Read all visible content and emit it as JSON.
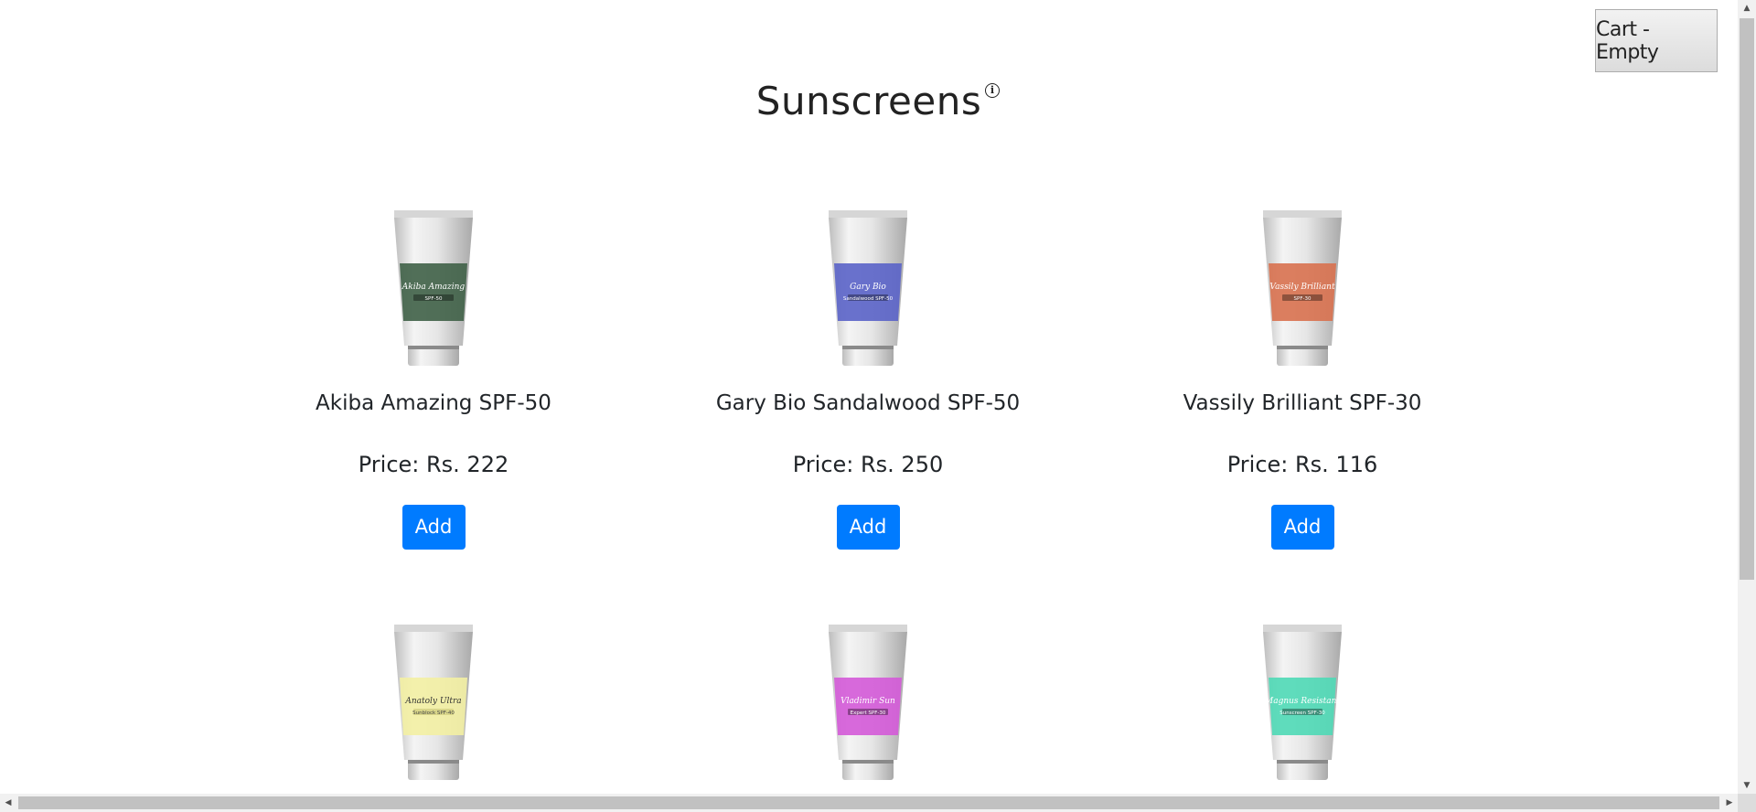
{
  "cart": {
    "label": "Cart - Empty"
  },
  "page": {
    "title": "Sunscreens",
    "info_icon": "info-icon"
  },
  "products": [
    {
      "name": "Akiba Amazing SPF-50",
      "price": "Price: Rs. 222",
      "button": "Add",
      "label_text": "Akiba Amazing",
      "label_sub": "SPF-50",
      "color": "#3f6147"
    },
    {
      "name": "Gary Bio Sandalwood SPF-50",
      "price": "Price: Rs. 250",
      "button": "Add",
      "label_text": "Gary Bio",
      "label_sub": "Sandalwood SPF-50",
      "color": "#5a63c8"
    },
    {
      "name": "Vassily Brilliant SPF-30",
      "price": "Price: Rs. 116",
      "button": "Add",
      "label_text": "Vassily Brilliant",
      "label_sub": "SPF-30",
      "color": "#d8714f"
    },
    {
      "label_text": "Anatoly Ultra",
      "label_sub": "Sunblock SPF-40",
      "color": "#f3f0a3"
    },
    {
      "label_text": "Vladimir Sun",
      "label_sub": "Expert SPF-30",
      "color": "#d45ad8"
    },
    {
      "label_text": "Magnus Resistant",
      "label_sub": "Sunscreen SPF-30",
      "color": "#4fd9b6"
    }
  ],
  "scrollbars": {
    "up": "▲",
    "down": "▼",
    "left": "◀",
    "right": "▶"
  }
}
